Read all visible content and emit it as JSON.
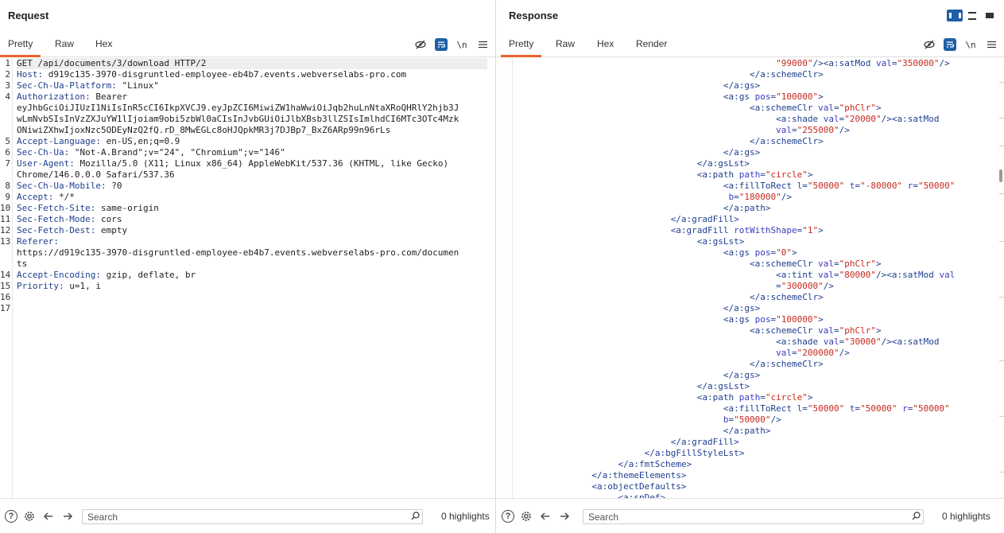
{
  "request": {
    "title": "Request",
    "tabs": [
      "Pretty",
      "Raw",
      "Hex"
    ],
    "active_tab": "Pretty",
    "tools": {
      "eye": "eye-off-icon",
      "wrap": "wrap-toggle-icon",
      "newline": "\\n",
      "menu": "menu-icon"
    },
    "lines": [
      {
        "n": "1",
        "text": "GET /api/documents/3/download HTTP/2"
      },
      {
        "n": "2",
        "k": "Host",
        "v": " d919c135-3970-disgruntled-employee-eb4b7.events.webverselabs-pro.com"
      },
      {
        "n": "3",
        "k": "Sec-Ch-Ua-Platform",
        "v": " \"Linux\""
      },
      {
        "n": "4",
        "k": "Authorization",
        "v": " Bearer"
      },
      {
        "n": "",
        "text": "eyJhbGciOiJIUzI1NiIsInR5cCI6IkpXVCJ9.eyJpZCI6MiwiZW1haWwiOiJqb2huLnNtaXRoQHRlY2hjb3J"
      },
      {
        "n": "",
        "text": "wLmNvbSIsInVzZXJuYW1lIjoiam9obi5zbWl0aCIsInJvbGUiOiJlbXBsb3llZSIsImlhdCI6MTc3OTc4Mzk"
      },
      {
        "n": "",
        "text": "ONiwiZXhwIjoxNzc5ODEyNzQ2fQ.rD_8MwEGLc8oHJQpkMR3j7DJBp7_BxZ6ARp99n96rLs"
      },
      {
        "n": "5",
        "k": "Accept-Language",
        "v": " en-US,en;q=0.9"
      },
      {
        "n": "6",
        "k": "Sec-Ch-Ua",
        "v": " \"Not-A.Brand\";v=\"24\", \"Chromium\";v=\"146\""
      },
      {
        "n": "7",
        "k": "User-Agent",
        "v": " Mozilla/5.0 (X11; Linux x86_64) AppleWebKit/537.36 (KHTML, like Gecko)"
      },
      {
        "n": "",
        "text": "Chrome/146.0.0.0 Safari/537.36"
      },
      {
        "n": "8",
        "k": "Sec-Ch-Ua-Mobile",
        "v": " ?0"
      },
      {
        "n": "9",
        "k": "Accept",
        "v": " */*"
      },
      {
        "n": "10",
        "k": "Sec-Fetch-Site",
        "v": " same-origin"
      },
      {
        "n": "11",
        "k": "Sec-Fetch-Mode",
        "v": " cors"
      },
      {
        "n": "12",
        "k": "Sec-Fetch-Dest",
        "v": " empty"
      },
      {
        "n": "13",
        "k": "Referer",
        "v": ""
      },
      {
        "n": "",
        "text": "https://d919c135-3970-disgruntled-employee-eb4b7.events.webverselabs-pro.com/documen"
      },
      {
        "n": "",
        "text": "ts"
      },
      {
        "n": "14",
        "k": "Accept-Encoding",
        "v": " gzip, deflate, br"
      },
      {
        "n": "15",
        "k": "Priority",
        "v": " u=1, i"
      },
      {
        "n": "16",
        "text": ""
      },
      {
        "n": "17",
        "text": ""
      }
    ],
    "footer": {
      "search_placeholder": "Search",
      "highlights": "0 highlights"
    }
  },
  "response": {
    "title": "Response",
    "tabs": [
      "Pretty",
      "Raw",
      "Hex",
      "Render"
    ],
    "active_tab": "Pretty",
    "lines": [
      {
        "indent": 50,
        "parts": [
          [
            "av",
            "\"99000\""
          ],
          [
            "tg",
            "/><a:satMod "
          ],
          [
            "at",
            "val"
          ],
          [
            "tg",
            "="
          ],
          [
            "av",
            "\"350000\""
          ],
          [
            "tg",
            "/>"
          ]
        ]
      },
      {
        "indent": 45,
        "parts": [
          [
            "tg",
            "</a:schemeClr>"
          ]
        ]
      },
      {
        "indent": 40,
        "parts": [
          [
            "tg",
            "</a:gs>"
          ]
        ]
      },
      {
        "indent": 40,
        "parts": [
          [
            "tg",
            "<a:gs "
          ],
          [
            "at",
            "pos"
          ],
          [
            "tg",
            "="
          ],
          [
            "av",
            "\"100000\""
          ],
          [
            "tg",
            ">"
          ]
        ]
      },
      {
        "indent": 45,
        "parts": [
          [
            "tg",
            "<a:schemeClr "
          ],
          [
            "at",
            "val"
          ],
          [
            "tg",
            "="
          ],
          [
            "av",
            "\"phClr\""
          ],
          [
            "tg",
            ">"
          ]
        ]
      },
      {
        "indent": 50,
        "parts": [
          [
            "tg",
            "<a:shade "
          ],
          [
            "at",
            "val"
          ],
          [
            "tg",
            "="
          ],
          [
            "av",
            "\"20000\""
          ],
          [
            "tg",
            "/><a:satMod"
          ]
        ]
      },
      {
        "indent": 50,
        "parts": [
          [
            "at",
            "val"
          ],
          [
            "tg",
            "="
          ],
          [
            "av",
            "\"255000\""
          ],
          [
            "tg",
            "/>"
          ]
        ]
      },
      {
        "indent": 45,
        "parts": [
          [
            "tg",
            "</a:schemeClr>"
          ]
        ]
      },
      {
        "indent": 40,
        "parts": [
          [
            "tg",
            "</a:gs>"
          ]
        ]
      },
      {
        "indent": 35,
        "parts": [
          [
            "tg",
            "</a:gsLst>"
          ]
        ]
      },
      {
        "indent": 35,
        "parts": [
          [
            "tg",
            "<a:path "
          ],
          [
            "at",
            "path"
          ],
          [
            "tg",
            "="
          ],
          [
            "av",
            "\"circle\""
          ],
          [
            "tg",
            ">"
          ]
        ]
      },
      {
        "indent": 40,
        "parts": [
          [
            "tg",
            "<a:fillToRect "
          ],
          [
            "at",
            "l"
          ],
          [
            "tg",
            "="
          ],
          [
            "av",
            "\"50000\""
          ],
          [
            "tg",
            " "
          ],
          [
            "at",
            "t"
          ],
          [
            "tg",
            "="
          ],
          [
            "av",
            "\"-80000\""
          ],
          [
            "tg",
            " "
          ],
          [
            "at",
            "r"
          ],
          [
            "tg",
            "="
          ],
          [
            "av",
            "\"50000\""
          ]
        ]
      },
      {
        "indent": 41,
        "parts": [
          [
            "at",
            "b"
          ],
          [
            "tg",
            "="
          ],
          [
            "av",
            "\"180000\""
          ],
          [
            "tg",
            "/>"
          ]
        ]
      },
      {
        "indent": 40,
        "parts": [
          [
            "tg",
            "</a:path>"
          ]
        ]
      },
      {
        "indent": 30,
        "parts": [
          [
            "tg",
            "</a:gradFill>"
          ]
        ]
      },
      {
        "indent": 30,
        "parts": [
          [
            "tg",
            "<a:gradFill "
          ],
          [
            "at",
            "rotWithShape"
          ],
          [
            "tg",
            "="
          ],
          [
            "av",
            "\"1\""
          ],
          [
            "tg",
            ">"
          ]
        ]
      },
      {
        "indent": 35,
        "parts": [
          [
            "tg",
            "<a:gsLst>"
          ]
        ]
      },
      {
        "indent": 40,
        "parts": [
          [
            "tg",
            "<a:gs "
          ],
          [
            "at",
            "pos"
          ],
          [
            "tg",
            "="
          ],
          [
            "av",
            "\"0\""
          ],
          [
            "tg",
            ">"
          ]
        ]
      },
      {
        "indent": 45,
        "parts": [
          [
            "tg",
            "<a:schemeClr "
          ],
          [
            "at",
            "val"
          ],
          [
            "tg",
            "="
          ],
          [
            "av",
            "\"phClr\""
          ],
          [
            "tg",
            ">"
          ]
        ]
      },
      {
        "indent": 50,
        "parts": [
          [
            "tg",
            "<a:tint "
          ],
          [
            "at",
            "val"
          ],
          [
            "tg",
            "="
          ],
          [
            "av",
            "\"80000\""
          ],
          [
            "tg",
            "/><a:satMod "
          ],
          [
            "at",
            "val"
          ]
        ]
      },
      {
        "indent": 50,
        "parts": [
          [
            "tg",
            "="
          ],
          [
            "av",
            "\"300000\""
          ],
          [
            "tg",
            "/>"
          ]
        ]
      },
      {
        "indent": 45,
        "parts": [
          [
            "tg",
            "</a:schemeClr>"
          ]
        ]
      },
      {
        "indent": 40,
        "parts": [
          [
            "tg",
            "</a:gs>"
          ]
        ]
      },
      {
        "indent": 40,
        "parts": [
          [
            "tg",
            "<a:gs "
          ],
          [
            "at",
            "pos"
          ],
          [
            "tg",
            "="
          ],
          [
            "av",
            "\"100000\""
          ],
          [
            "tg",
            ">"
          ]
        ]
      },
      {
        "indent": 45,
        "parts": [
          [
            "tg",
            "<a:schemeClr "
          ],
          [
            "at",
            "val"
          ],
          [
            "tg",
            "="
          ],
          [
            "av",
            "\"phClr\""
          ],
          [
            "tg",
            ">"
          ]
        ]
      },
      {
        "indent": 50,
        "parts": [
          [
            "tg",
            "<a:shade "
          ],
          [
            "at",
            "val"
          ],
          [
            "tg",
            "="
          ],
          [
            "av",
            "\"30000\""
          ],
          [
            "tg",
            "/><a:satMod"
          ]
        ]
      },
      {
        "indent": 50,
        "parts": [
          [
            "at",
            "val"
          ],
          [
            "tg",
            "="
          ],
          [
            "av",
            "\"200000\""
          ],
          [
            "tg",
            "/>"
          ]
        ]
      },
      {
        "indent": 45,
        "parts": [
          [
            "tg",
            "</a:schemeClr>"
          ]
        ]
      },
      {
        "indent": 40,
        "parts": [
          [
            "tg",
            "</a:gs>"
          ]
        ]
      },
      {
        "indent": 35,
        "parts": [
          [
            "tg",
            "</a:gsLst>"
          ]
        ]
      },
      {
        "indent": 35,
        "parts": [
          [
            "tg",
            "<a:path "
          ],
          [
            "at",
            "path"
          ],
          [
            "tg",
            "="
          ],
          [
            "av",
            "\"circle\""
          ],
          [
            "tg",
            ">"
          ]
        ]
      },
      {
        "indent": 40,
        "parts": [
          [
            "tg",
            "<a:fillToRect "
          ],
          [
            "at",
            "l"
          ],
          [
            "tg",
            "="
          ],
          [
            "av",
            "\"50000\""
          ],
          [
            "tg",
            " "
          ],
          [
            "at",
            "t"
          ],
          [
            "tg",
            "="
          ],
          [
            "av",
            "\"50000\""
          ],
          [
            "tg",
            " "
          ],
          [
            "at",
            "r"
          ],
          [
            "tg",
            "="
          ],
          [
            "av",
            "\"50000\""
          ]
        ]
      },
      {
        "indent": 40,
        "parts": [
          [
            "at",
            "b"
          ],
          [
            "tg",
            "="
          ],
          [
            "av",
            "\"50000\""
          ],
          [
            "tg",
            "/>"
          ]
        ]
      },
      {
        "indent": 40,
        "parts": [
          [
            "tg",
            "</a:path>"
          ]
        ]
      },
      {
        "indent": 30,
        "parts": [
          [
            "tg",
            "</a:gradFill>"
          ]
        ]
      },
      {
        "indent": 25,
        "parts": [
          [
            "tg",
            "</a:bgFillStyleLst>"
          ]
        ]
      },
      {
        "indent": 20,
        "parts": [
          [
            "tg",
            "</a:fmtScheme>"
          ]
        ]
      },
      {
        "indent": 15,
        "parts": [
          [
            "tg",
            "</a:themeElements>"
          ]
        ]
      },
      {
        "indent": 15,
        "parts": [
          [
            "tg",
            "<a:objectDefaults>"
          ]
        ]
      },
      {
        "indent": 20,
        "parts": [
          [
            "tg",
            "<a:spDef>"
          ]
        ]
      }
    ],
    "footer": {
      "search_placeholder": "Search",
      "highlights": "0 highlights"
    }
  },
  "colors": {
    "accent_tab": "#e8632b",
    "toggle_active": "#1f5fa6",
    "xml_tag": "#1f3f8f",
    "xml_attr": "#3b3bbd",
    "xml_value": "#c52a1e"
  }
}
